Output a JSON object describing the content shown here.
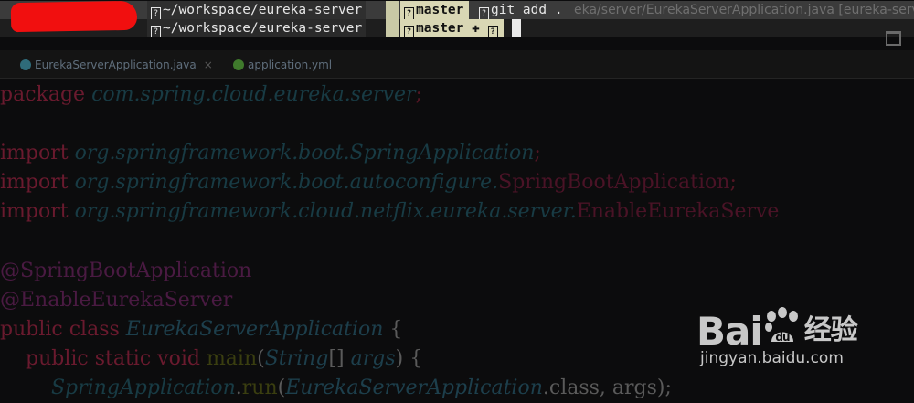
{
  "terminal": {
    "row1": {
      "path": "~/workspace/eureka-server",
      "branch": "master",
      "command": "git add .",
      "background_text": "eka/server/EurekaServerApplication.java [eureka-serve"
    },
    "row2": {
      "path": "~/workspace/eureka-server",
      "branch": "master",
      "dirty_mark": "✚"
    },
    "unknown_glyph": "?"
  },
  "tabs": [
    {
      "label": "EurekaServerApplication.java",
      "close": "×"
    },
    {
      "label": "application.yml"
    }
  ],
  "code": {
    "l1": {
      "kw": "package",
      "pkg": "com.spring.cloud.eureka.server",
      "semi": ";"
    },
    "l2": {
      "kw": "import",
      "pkg": "org.springframework.boot.",
      "cls": "SpringApplication",
      "semi": ";"
    },
    "l3": {
      "kw": "import",
      "pkg": "org.springframework.boot.autoconfigure.",
      "cls": "SpringBootApplication",
      "semi": ";"
    },
    "l4": {
      "kw": "import",
      "pkg": "org.springframework.cloud.netflix.eureka.server.",
      "cls": "EnableEurekaServe"
    },
    "l5": {
      "ann": "@SpringBootApplication"
    },
    "l6": {
      "ann": "@EnableEurekaServer"
    },
    "l7": {
      "kw": "public class",
      "name": "EurekaServerApplication",
      "brace": "{"
    },
    "l8": {
      "kw": "public static void",
      "fn": "main",
      "p1": "(",
      "type": "String",
      "arr": "[]",
      "arg": "args",
      "p2": ")",
      "brace": "{"
    },
    "l9": {
      "cls": "SpringApplication",
      "dot": ".",
      "fn": "run",
      "p1": "(",
      "arg": "EurekaServerApplication",
      "rest": ".class, args);"
    }
  },
  "watermark": {
    "brand_latin": "Bai",
    "brand_cn": "经验",
    "url": "jingyan.baidu.com"
  },
  "colors": {
    "redaction": "#f10f0f",
    "terminal_bg": "#1e1e1e",
    "branch_bg": "#d9d7b4"
  }
}
